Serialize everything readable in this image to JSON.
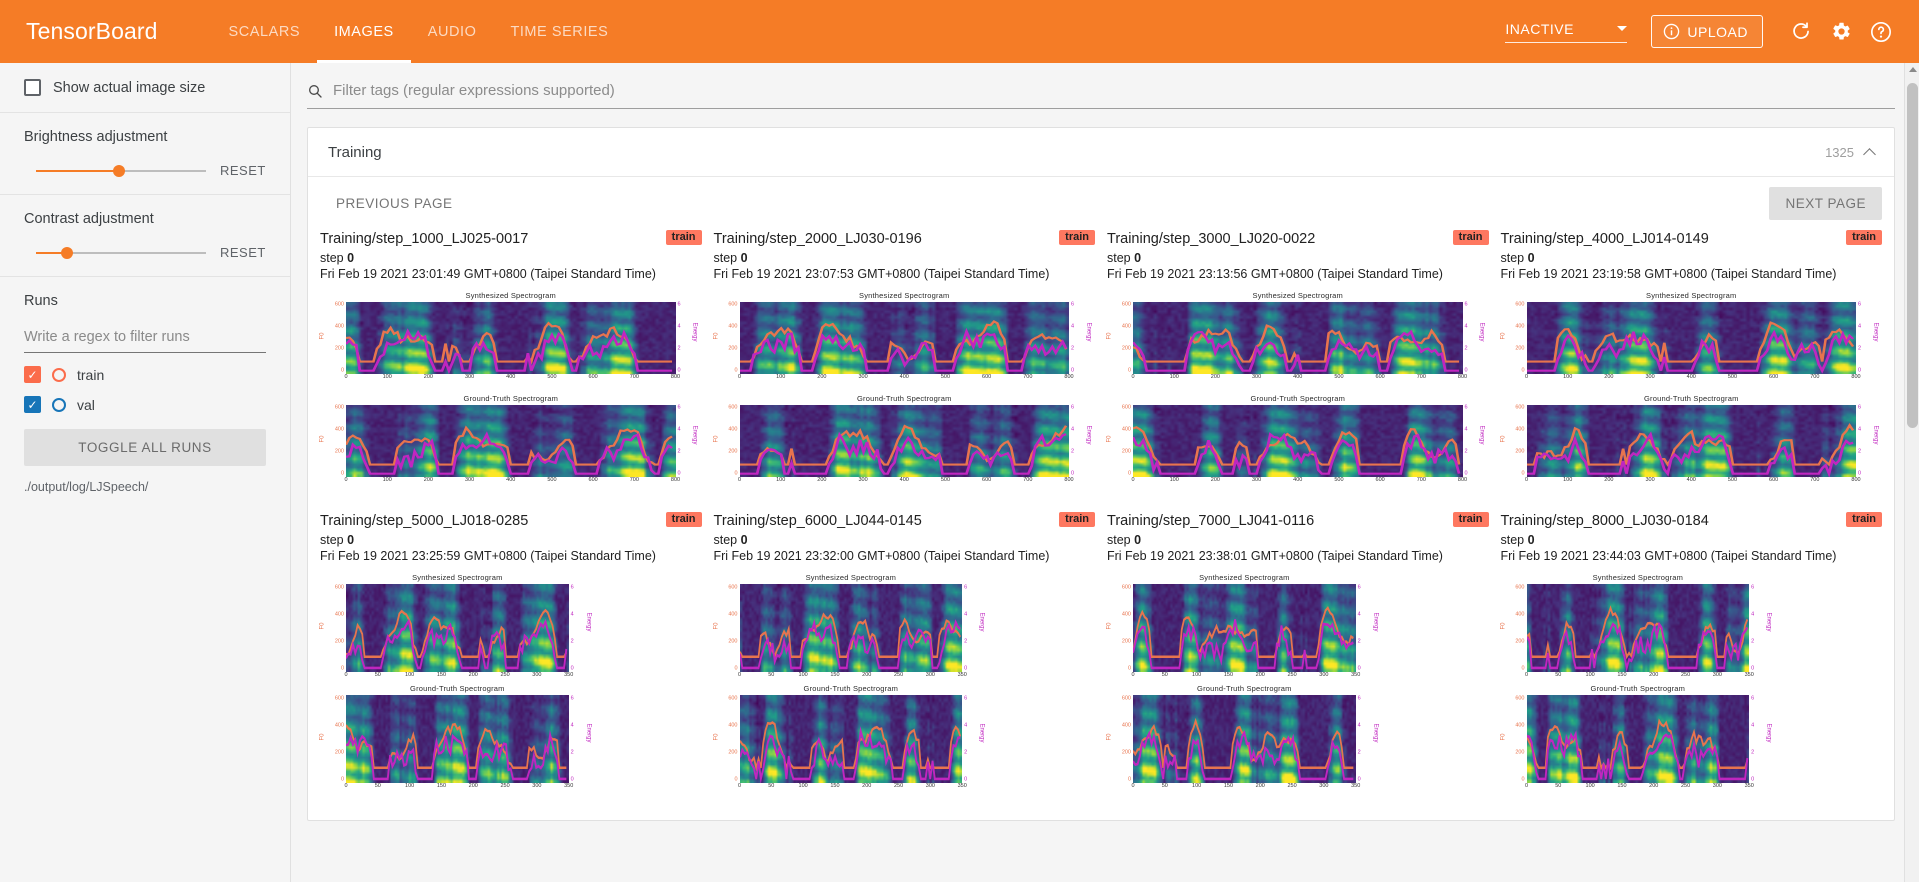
{
  "app": {
    "brand": "TensorBoard",
    "tabs": [
      {
        "label": "SCALARS",
        "active": false
      },
      {
        "label": "IMAGES",
        "active": true
      },
      {
        "label": "AUDIO",
        "active": false
      },
      {
        "label": "TIME SERIES",
        "active": false
      }
    ],
    "run_state": "INACTIVE",
    "upload_label": "UPLOAD",
    "icons": {
      "info": "info-icon",
      "refresh": "refresh-icon",
      "settings": "gear-icon",
      "help": "help-icon"
    },
    "accent_color": "#f57c26"
  },
  "sidebar": {
    "show_actual_size_label": "Show actual image size",
    "show_actual_size_checked": false,
    "brightness": {
      "label": "Brightness adjustment",
      "reset_label": "RESET",
      "value_pct": 49
    },
    "contrast": {
      "label": "Contrast adjustment",
      "reset_label": "RESET",
      "value_pct": 18
    },
    "runs": {
      "title": "Runs",
      "filter_placeholder": "Write a regex to filter runs",
      "filter_value": "",
      "items": [
        {
          "name": "train",
          "color": "#fb6c4b",
          "checked": true
        },
        {
          "name": "val",
          "color": "#1775b8",
          "checked": true
        }
      ],
      "toggle_all_label": "TOGGLE ALL RUNS",
      "logdir": "./output/log/LJSpeech/"
    }
  },
  "main": {
    "filter_placeholder": "Filter tags (regular expressions supported)",
    "filter_value": "",
    "search_icon": "search-icon",
    "card": {
      "title": "Training",
      "count": "1325",
      "collapse_icon": "chevron-up-icon",
      "prev_label": "PREVIOUS PAGE",
      "next_label": "NEXT PAGE"
    },
    "images": [
      {
        "title": "Training/step_1000_LJ025-0017",
        "badge": "train",
        "step_label": "step",
        "step_value": "0",
        "time": "Fri Feb 19 2021 23:01:49 GMT+0800 (Taipei Standard Time)",
        "row": 1
      },
      {
        "title": "Training/step_2000_LJ030-0196",
        "badge": "train",
        "step_label": "step",
        "step_value": "0",
        "time": "Fri Feb 19 2021 23:07:53 GMT+0800 (Taipei Standard Time)",
        "row": 1
      },
      {
        "title": "Training/step_3000_LJ020-0022",
        "badge": "train",
        "step_label": "step",
        "step_value": "0",
        "time": "Fri Feb 19 2021 23:13:56 GMT+0800 (Taipei Standard Time)",
        "row": 1
      },
      {
        "title": "Training/step_4000_LJ014-0149",
        "badge": "train",
        "step_label": "step",
        "step_value": "0",
        "time": "Fri Feb 19 2021 23:19:58 GMT+0800 (Taipei Standard Time)",
        "row": 1
      },
      {
        "title": "Training/step_5000_LJ018-0285",
        "badge": "train",
        "step_label": "step",
        "step_value": "0",
        "time": "Fri Feb 19 2021 23:25:59 GMT+0800 (Taipei Standard Time)",
        "row": 2
      },
      {
        "title": "Training/step_6000_LJ044-0145",
        "badge": "train",
        "step_label": "step",
        "step_value": "0",
        "time": "Fri Feb 19 2021 23:32:00 GMT+0800 (Taipei Standard Time)",
        "row": 2
      },
      {
        "title": "Training/step_7000_LJ041-0116",
        "badge": "train",
        "step_label": "step",
        "step_value": "0",
        "time": "Fri Feb 19 2021 23:38:01 GMT+0800 (Taipei Standard Time)",
        "row": 2
      },
      {
        "title": "Training/step_8000_LJ030-0184",
        "badge": "train",
        "step_label": "step",
        "step_value": "0",
        "time": "Fri Feb 19 2021 23:44:03 GMT+0800 (Taipei Standard Time)",
        "row": 2
      }
    ]
  },
  "chart_data": {
    "type": "heatmap",
    "description": "Each image card shows two stacked mel-spectrogram heatmaps (viridis colormap) with an F0 contour (orange, left axis) and an Energy contour (magenta, right axis) overlaid.",
    "figures": [
      {
        "title": "Synthesized Spectrogram",
        "xlabel": "",
        "ylabel_left": "F0",
        "ylabel_right": "Energy",
        "left_ticks": [
          "0",
          "200",
          "400",
          "600"
        ],
        "right_ticks": [
          "0",
          "2",
          "4",
          "6"
        ],
        "x_ticks_row1": [
          "0",
          "100",
          "200",
          "300",
          "400",
          "500",
          "600",
          "700",
          "800"
        ],
        "x_ticks_row2": [
          "0",
          "50",
          "100",
          "150",
          "200",
          "250",
          "300",
          "350"
        ],
        "left_axis_color": "#e8744e",
        "right_axis_color": "#c026c0",
        "colormap": "viridis"
      },
      {
        "title": "Ground-Truth Spectrogram",
        "xlabel": "",
        "ylabel_left": "F0",
        "ylabel_right": "Energy",
        "left_ticks": [
          "0",
          "200",
          "400",
          "600"
        ],
        "right_ticks": [
          "0",
          "2",
          "4",
          "6"
        ],
        "x_ticks_row1": [
          "0",
          "100",
          "200",
          "300",
          "400",
          "500",
          "600",
          "700",
          "800"
        ],
        "x_ticks_row2": [
          "0",
          "50",
          "100",
          "150",
          "200",
          "250",
          "300",
          "350"
        ],
        "left_axis_color": "#e8744e",
        "right_axis_color": "#c026c0",
        "colormap": "viridis"
      }
    ]
  }
}
